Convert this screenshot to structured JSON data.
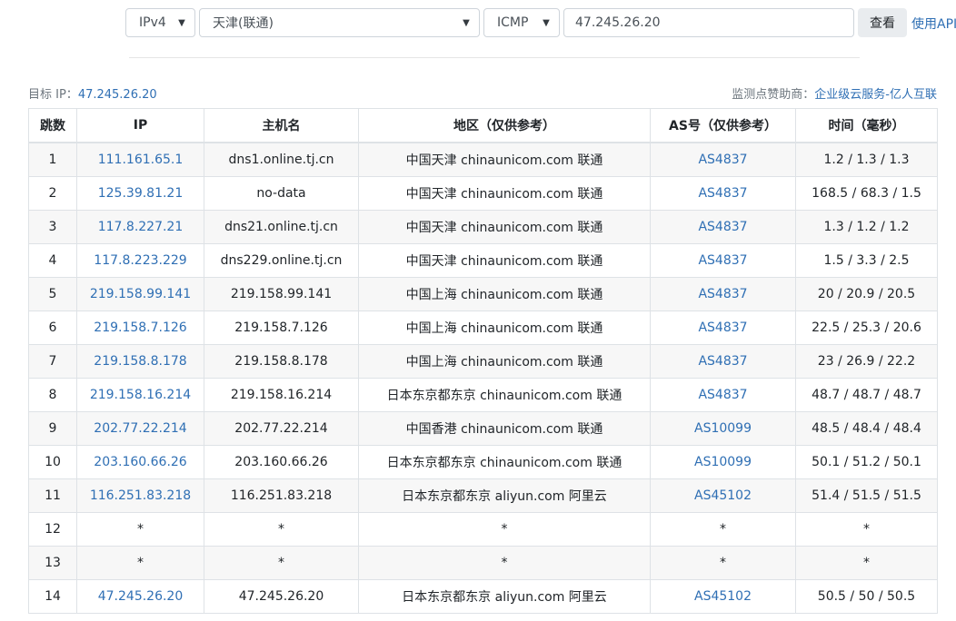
{
  "toolbar": {
    "ip_version": "IPv4",
    "node": "天津(联通)",
    "protocol": "ICMP",
    "target_input": "47.245.26.20",
    "query_button": "查看",
    "api_link": "使用API"
  },
  "info": {
    "target_label": "目标 IP：",
    "target_ip": "47.245.26.20",
    "sponsor_label": "监测点赞助商：",
    "sponsor_name": "企业级云服务-亿人互联"
  },
  "table": {
    "headers": [
      "跳数",
      "IP",
      "主机名",
      "地区（仅供参考）",
      "AS号（仅供参考）",
      "时间（毫秒）"
    ],
    "rows": [
      {
        "hop": "1",
        "ip": "111.161.65.1",
        "host": "dns1.online.tj.cn",
        "region": "中国天津 chinaunicom.com 联通",
        "as": "AS4837",
        "time": "1.2 / 1.3 / 1.3"
      },
      {
        "hop": "2",
        "ip": "125.39.81.21",
        "host": "no-data",
        "region": "中国天津 chinaunicom.com 联通",
        "as": "AS4837",
        "time": "168.5 / 68.3 / 1.5"
      },
      {
        "hop": "3",
        "ip": "117.8.227.21",
        "host": "dns21.online.tj.cn",
        "region": "中国天津 chinaunicom.com 联通",
        "as": "AS4837",
        "time": "1.3 / 1.2 / 1.2"
      },
      {
        "hop": "4",
        "ip": "117.8.223.229",
        "host": "dns229.online.tj.cn",
        "region": "中国天津 chinaunicom.com 联通",
        "as": "AS4837",
        "time": "1.5 / 3.3 / 2.5"
      },
      {
        "hop": "5",
        "ip": "219.158.99.141",
        "host": "219.158.99.141",
        "region": "中国上海 chinaunicom.com 联通",
        "as": "AS4837",
        "time": "20 / 20.9 / 20.5"
      },
      {
        "hop": "6",
        "ip": "219.158.7.126",
        "host": "219.158.7.126",
        "region": "中国上海 chinaunicom.com 联通",
        "as": "AS4837",
        "time": "22.5 / 25.3 / 20.6"
      },
      {
        "hop": "7",
        "ip": "219.158.8.178",
        "host": "219.158.8.178",
        "region": "中国上海 chinaunicom.com 联通",
        "as": "AS4837",
        "time": "23 / 26.9 / 22.2"
      },
      {
        "hop": "8",
        "ip": "219.158.16.214",
        "host": "219.158.16.214",
        "region": "日本东京都东京 chinaunicom.com 联通",
        "as": "AS4837",
        "time": "48.7 / 48.7 / 48.7"
      },
      {
        "hop": "9",
        "ip": "202.77.22.214",
        "host": "202.77.22.214",
        "region": "中国香港 chinaunicom.com 联通",
        "as": "AS10099",
        "time": "48.5 / 48.4 / 48.4"
      },
      {
        "hop": "10",
        "ip": "203.160.66.26",
        "host": "203.160.66.26",
        "region": "日本东京都东京 chinaunicom.com 联通",
        "as": "AS10099",
        "time": "50.1 / 51.2 / 50.1"
      },
      {
        "hop": "11",
        "ip": "116.251.83.218",
        "host": "116.251.83.218",
        "region": "日本东京都东京 aliyun.com 阿里云",
        "as": "AS45102",
        "time": "51.4 / 51.5 / 51.5"
      },
      {
        "hop": "12",
        "ip": "*",
        "host": "*",
        "region": "*",
        "as": "*",
        "time": "*"
      },
      {
        "hop": "13",
        "ip": "*",
        "host": "*",
        "region": "*",
        "as": "*",
        "time": "*"
      },
      {
        "hop": "14",
        "ip": "47.245.26.20",
        "host": "47.245.26.20",
        "region": "日本东京都东京 aliyun.com 阿里云",
        "as": "AS45102",
        "time": "50.5 / 50 / 50.5"
      }
    ]
  }
}
